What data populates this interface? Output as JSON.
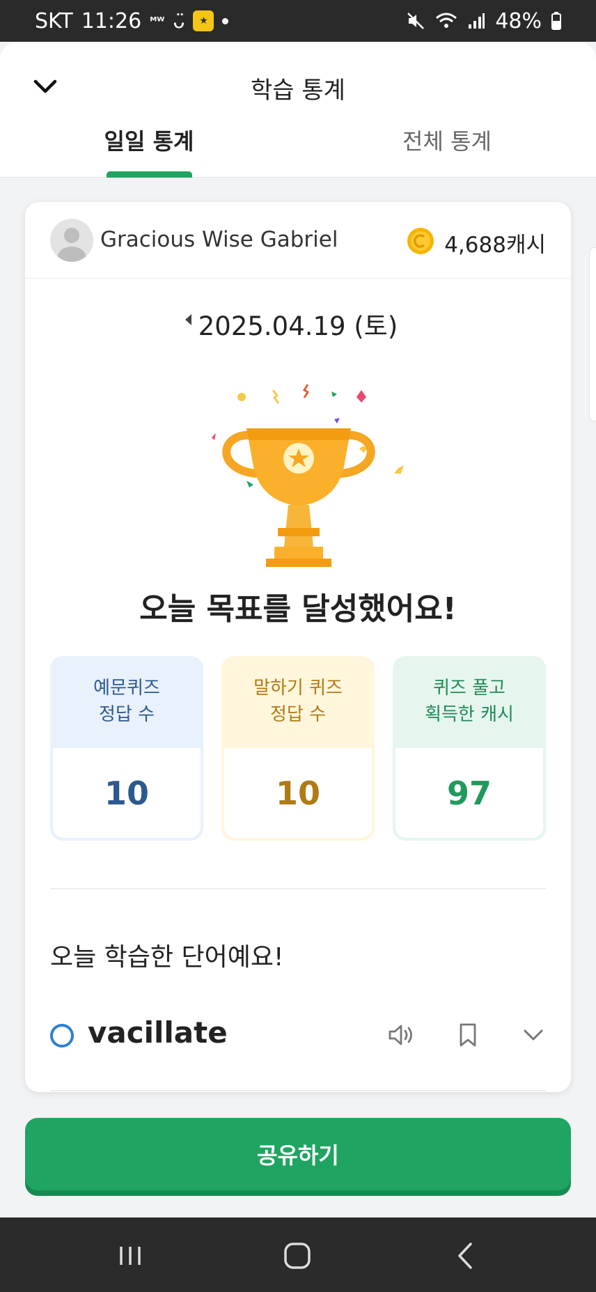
{
  "status_bar": {
    "carrier": "SKT",
    "time": "11:26",
    "battery": "48%"
  },
  "header": {
    "title": "학습 통계",
    "tabs": [
      {
        "label": "일일 통계",
        "active": true
      },
      {
        "label": "전체 통계",
        "active": false
      }
    ]
  },
  "user": {
    "name": "Gracious Wise Gabriel",
    "cash": "4,688캐시"
  },
  "date": "2025.04.19 (토)",
  "goal_message": "오늘 목표를 달성했어요!",
  "stats": [
    {
      "label_line1": "예문퀴즈",
      "label_line2": "정답 수",
      "value": "10"
    },
    {
      "label_line1": "말하기 퀴즈",
      "label_line2": "정답 수",
      "value": "10"
    },
    {
      "label_line1": "퀴즈 풀고",
      "label_line2": "획득한 캐시",
      "value": "97"
    }
  ],
  "words_section": {
    "title": "오늘 학습한 단어예요!",
    "words": [
      {
        "word": "vacillate"
      }
    ]
  },
  "share_button": "공유하기",
  "colors": {
    "accent_green": "#1fa461",
    "blue": "#2c5a8f",
    "gold": "#b07a17",
    "green_text": "#1f9a5b"
  }
}
